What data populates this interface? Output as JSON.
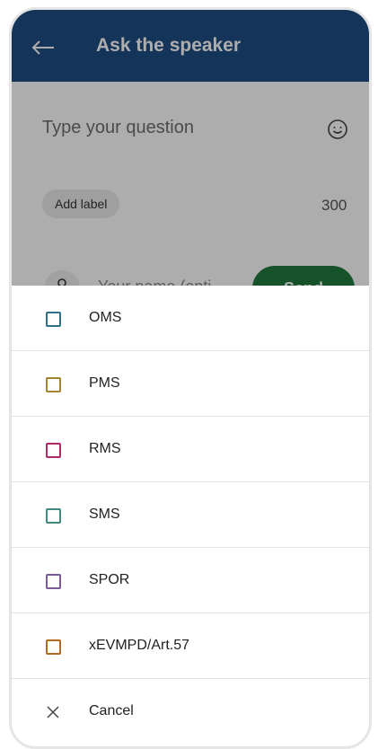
{
  "appbar": {
    "title": "Ask the speaker",
    "back_icon": "arrow-left-icon",
    "color": "#1f4d83"
  },
  "form": {
    "question_placeholder": "Type your question",
    "emoji_icon": "smiley-icon",
    "label_chip": "Add label",
    "char_count": "300",
    "name_placeholder": "Your name (opti",
    "send_label": "Send",
    "send_color": "#1f7a3e"
  },
  "sheet": {
    "items": [
      {
        "label": "OMS",
        "color": "#2e6f88"
      },
      {
        "label": "PMS",
        "color": "#a8832e"
      },
      {
        "label": "RMS",
        "color": "#b02a6a"
      },
      {
        "label": "SMS",
        "color": "#3f8a80"
      },
      {
        "label": "SPOR",
        "color": "#7c5a9a"
      },
      {
        "label": "xEVMPD/Art.57",
        "color": "#b26a22"
      }
    ],
    "cancel_label": "Cancel",
    "cancel_icon": "close-icon"
  }
}
